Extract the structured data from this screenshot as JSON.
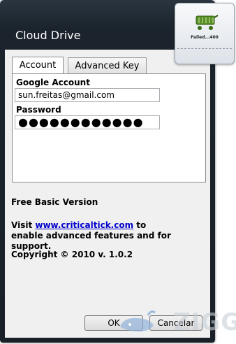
{
  "window": {
    "title": "Cloud Drive"
  },
  "tabs": [
    {
      "label": "Account",
      "active": true
    },
    {
      "label": "Advanced Key",
      "active": false
    }
  ],
  "account": {
    "google_account_label": "Google Account",
    "google_account_value": "sun.freitas@gmail.com",
    "password_label": "Password",
    "password_value": "●●●●●●●●●●●●"
  },
  "info": {
    "version_text": "Free Basic Version",
    "visit_prefix": "Visit ",
    "visit_link": "www.criticaltick.com",
    "visit_suffix": " to enable advanced features and for support.",
    "copyright": "Copyright © 2010 v. 1.0.2"
  },
  "buttons": {
    "ok": "OK",
    "cancel": "Cancelar"
  },
  "gadget": {
    "status": "Failed...400",
    "icon": "shopping-cart-icon"
  },
  "watermark": {
    "text": "ZIGG"
  }
}
